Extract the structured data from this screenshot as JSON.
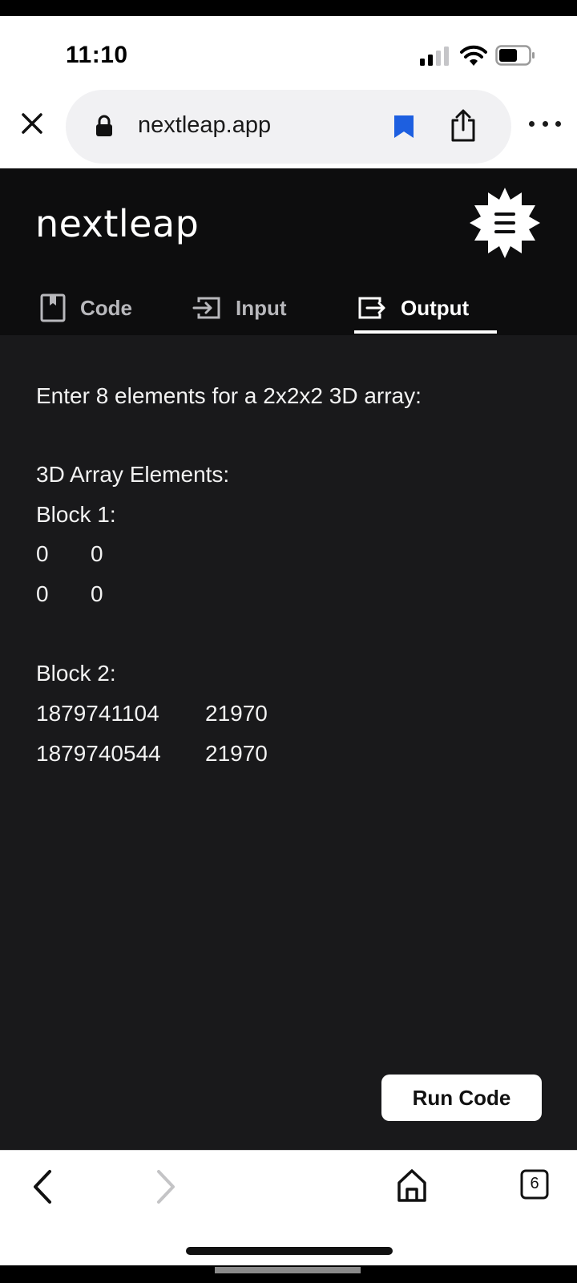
{
  "status_bar": {
    "time": "11:10"
  },
  "browser": {
    "url": "nextleap.app",
    "icons": [
      "close-icon",
      "lock-icon",
      "bookmark-icon",
      "share-icon",
      "more-icon"
    ],
    "accent_color": "#1d5fe0"
  },
  "app": {
    "logo": "nextleap",
    "tabs": [
      {
        "label": "Code",
        "icon": "book-icon",
        "active": false
      },
      {
        "label": "Input",
        "icon": "input-arrow-icon",
        "active": false
      },
      {
        "label": "Output",
        "icon": "output-arrow-icon",
        "active": true
      }
    ],
    "output": {
      "prompt": "Enter 8 elements for a 2x2x2 3D array:",
      "heading": "3D Array Elements:",
      "blocks": [
        {
          "title": "Block 1:",
          "rows": [
            [
              "0",
              "0"
            ],
            [
              "0",
              "0"
            ]
          ]
        },
        {
          "title": "Block 2:",
          "rows": [
            [
              "1879741104",
              "21970"
            ],
            [
              "1879740544",
              "21970"
            ]
          ]
        }
      ]
    },
    "run_button": "Run Code",
    "background_color": "#19191b",
    "header_color": "#0d0d0e"
  },
  "toolbar": {
    "tab_count": "6",
    "icons": [
      "back-icon",
      "forward-icon",
      "home-icon",
      "tabs-icon"
    ]
  }
}
